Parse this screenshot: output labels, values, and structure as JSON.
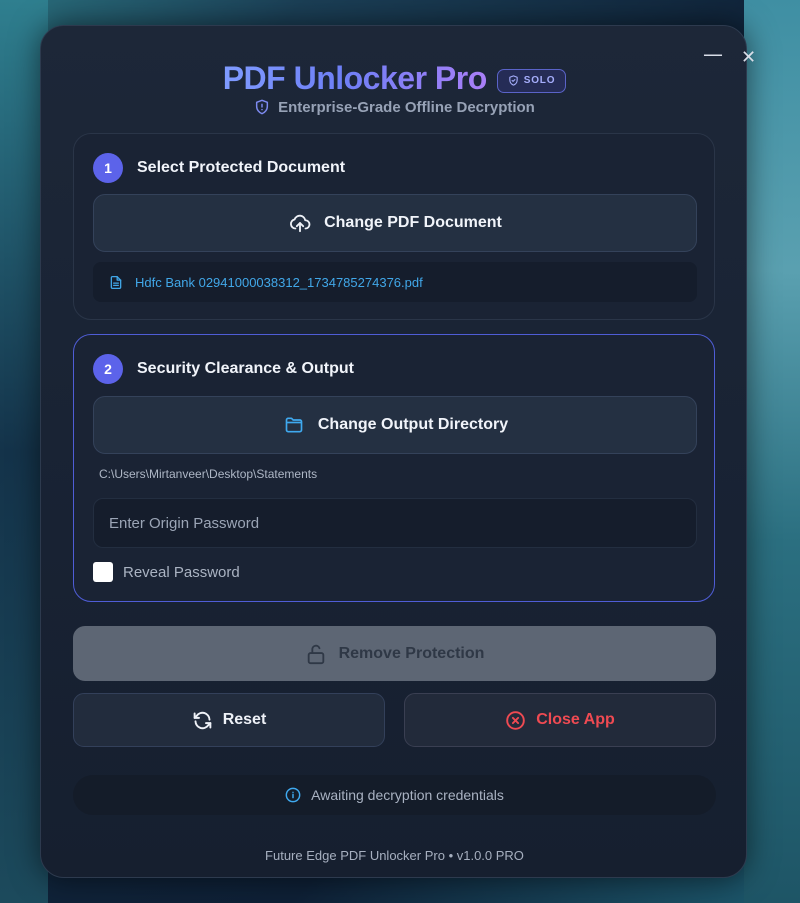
{
  "window": {
    "minimize_glyph": "—",
    "close_glyph": "✕"
  },
  "header": {
    "title": "PDF Unlocker Pro",
    "badge": "SOLO",
    "subtitle": "Enterprise-Grade Offline Decryption"
  },
  "step1": {
    "number": "1",
    "title": "Select Protected Document",
    "button_label": "Change PDF Document",
    "file_name": "Hdfc Bank 02941000038312_1734785274376.pdf"
  },
  "step2": {
    "number": "2",
    "title": "Security Clearance & Output",
    "button_label": "Change Output Directory",
    "output_path": "C:\\Users\\Mirtanveer\\Desktop\\Statements",
    "password_placeholder": "Enter Origin Password",
    "password_value": "",
    "reveal_label": "Reveal Password",
    "reveal_checked": false
  },
  "actions": {
    "remove_label": "Remove Protection",
    "reset_label": "Reset",
    "close_label": "Close App"
  },
  "status": {
    "text": "Awaiting decryption credentials"
  },
  "footer": {
    "text": "Future Edge PDF Unlocker Pro • v1.0.0 PRO"
  },
  "colors": {
    "accent": "#5c63ea",
    "file_link": "#41a7e8",
    "danger": "#ef4a52",
    "disabled_button": "#5d6674"
  },
  "icons": {
    "badge": "shield-check-icon",
    "subtitle": "shield-icon",
    "step1_button": "cloud-upload-icon",
    "file": "document-icon",
    "step2_button": "folder-icon",
    "remove": "unlock-icon",
    "reset": "refresh-icon",
    "close": "x-circle-icon",
    "status": "info-icon"
  }
}
